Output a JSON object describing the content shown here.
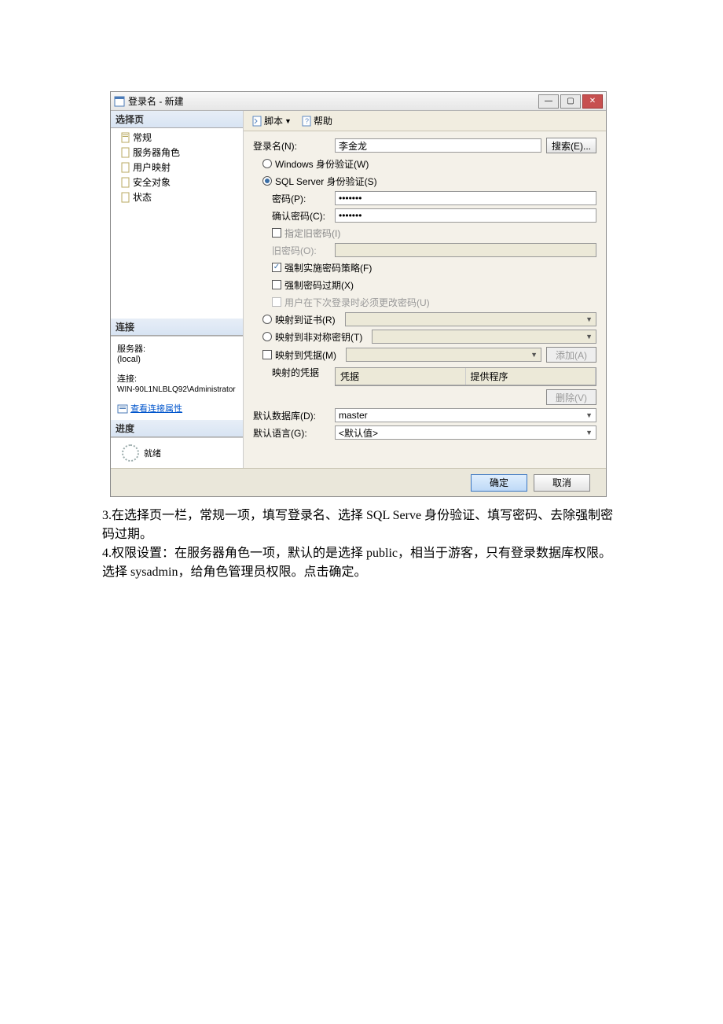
{
  "window": {
    "title": "登录名 - 新建",
    "controls": {
      "min": "—",
      "max": "▢",
      "close": "✕"
    }
  },
  "sidebar": {
    "select_page": "选择页",
    "items": [
      {
        "label": "常规"
      },
      {
        "label": "服务器角色"
      },
      {
        "label": "用户映射"
      },
      {
        "label": "安全对象"
      },
      {
        "label": "状态"
      }
    ],
    "connection_head": "连接",
    "server_lbl": "服务器:",
    "server_val": "(local)",
    "conn_lbl": "连接:",
    "conn_val": "WIN-90L1NLBLQ92\\Administrator",
    "view_conn": "查看连接属性",
    "progress_head": "进度",
    "progress_state": "就绪"
  },
  "toolbar": {
    "script": "脚本",
    "help": "帮助"
  },
  "form": {
    "login_name_lbl": "登录名(N):",
    "login_name_val": "李金龙",
    "search_btn": "搜索(E)...",
    "auth_win": "Windows 身份验证(W)",
    "auth_sql": "SQL Server 身份验证(S)",
    "password_lbl": "密码(P):",
    "password_val": "●●●●●●●",
    "confirm_lbl": "确认密码(C):",
    "confirm_val": "●●●●●●●",
    "specify_old": "指定旧密码(I)",
    "old_pw_lbl": "旧密码(O):",
    "enforce_policy": "强制实施密码策略(F)",
    "enforce_expire": "强制密码过期(X)",
    "must_change": "用户在下次登录时必须更改密码(U)",
    "map_cert": "映射到证书(R)",
    "map_asym": "映射到非对称密钥(T)",
    "map_cred": "映射到凭据(M)",
    "add_btn": "添加(A)",
    "creds_col_label": "映射的凭据",
    "grid_col1": "凭据",
    "grid_col2": "提供程序",
    "delete_btn": "删除(V)",
    "default_db_lbl": "默认数据库(D):",
    "default_db_val": "master",
    "default_lang_lbl": "默认语言(G):",
    "default_lang_val": "<默认值>"
  },
  "footer": {
    "ok": "确定",
    "cancel": "取消"
  },
  "below": {
    "p3": "3.在选择页一栏，常规一项，填写登录名、选择 SQL Serve 身份验证、填写密码、去除强制密码过期。",
    "p4": "4.权限设置：在服务器角色一项，默认的是选择 public，相当于游客，只有登录数据库权限。选择 sysadmin，给角色管理员权限。点击确定。"
  }
}
